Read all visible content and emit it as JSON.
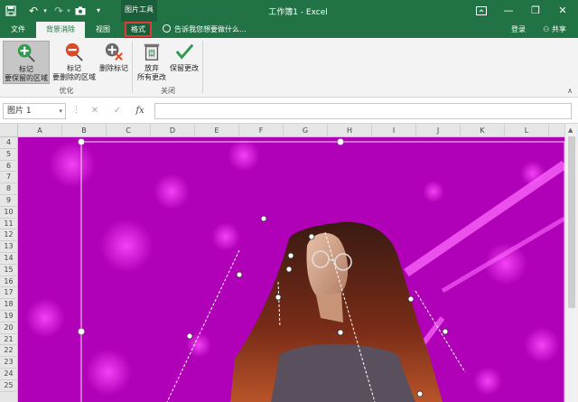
{
  "title_bar": {
    "context_tool_label": "图片工具",
    "window_title": "工作簿1 - Excel",
    "icons": [
      "save-icon",
      "undo-icon",
      "redo-icon",
      "camera-icon",
      "customize-qat-icon",
      "ribbon-display-icon",
      "minimize-icon",
      "restore-icon",
      "close-icon"
    ],
    "minimize": "—",
    "restore": "❐",
    "close": "✕"
  },
  "tabs": {
    "file": "文件",
    "background_removal": "背景消除",
    "view": "视图",
    "format": "格式",
    "tell_me": "告诉我您想要做什么...",
    "sign_in": "登录",
    "share": "共享"
  },
  "ribbon": {
    "mark_keep": "标记\n要保留的区域",
    "mark_keep_line1": "标记",
    "mark_keep_line2": "要保留的区域",
    "mark_remove_line1": "标记",
    "mark_remove_line2": "要删除的区域",
    "delete_mark": "删除标记",
    "discard_line1": "放弃",
    "discard_line2": "所有更改",
    "keep_changes": "保留更改",
    "group_refine": "优化",
    "group_close": "关闭",
    "accent_keep": "#2e9b4f",
    "accent_remove": "#d94a2b"
  },
  "formula_bar": {
    "name_box": "图片 1",
    "cancel": "✕",
    "enter": "✓",
    "fx": "fx",
    "formula": ""
  },
  "grid": {
    "columns": [
      "A",
      "B",
      "C",
      "D",
      "E",
      "F",
      "G",
      "H",
      "I",
      "J",
      "K",
      "L"
    ],
    "rows": [
      "4",
      "5",
      "6",
      "7",
      "8",
      "9",
      "10",
      "11",
      "12",
      "13",
      "14",
      "15",
      "16",
      "17",
      "18",
      "19",
      "20",
      "21",
      "22",
      "23",
      "24",
      "25"
    ],
    "removal_overlay_color": "#b000b8"
  }
}
